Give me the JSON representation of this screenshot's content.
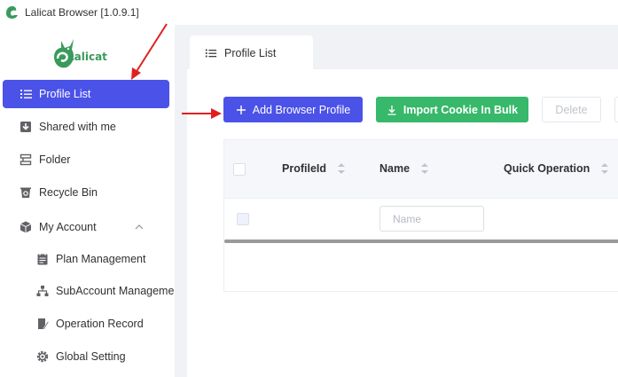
{
  "window": {
    "title": "Lalicat Browser  [1.0.9.1]"
  },
  "brand": {
    "name": "Lalicat"
  },
  "sidebar": {
    "items": [
      {
        "label": "Profile List",
        "icon": "list-icon",
        "active": true
      },
      {
        "label": "Shared with me",
        "icon": "download-icon"
      },
      {
        "label": "Folder",
        "icon": "folder-icon"
      },
      {
        "label": "Recycle Bin",
        "icon": "trash-icon"
      },
      {
        "label": "My Account",
        "icon": "box-icon",
        "expanded": true
      },
      {
        "label": "Plan Management",
        "icon": "calendar-icon",
        "sub": true
      },
      {
        "label": "SubAccount Managemen",
        "icon": "sitemap-icon",
        "sub": true
      },
      {
        "label": "Operation Record",
        "icon": "record-icon",
        "sub": true
      },
      {
        "label": "Global Setting",
        "icon": "gear-icon",
        "sub": true
      }
    ]
  },
  "tabs": [
    {
      "label": "Profile List",
      "icon": "list-icon"
    }
  ],
  "toolbar": {
    "add_label": "Add Browser Profile",
    "import_label": "Import Cookie In Bulk",
    "delete_label": "Delete"
  },
  "table": {
    "columns": [
      "ProfileId",
      "Name",
      "Quick Operation"
    ],
    "filters": {
      "name_placeholder": "Name"
    }
  },
  "colors": {
    "primary": "#4b52e8",
    "success": "#37b86a",
    "annotation": "#e02020",
    "brand": "#3a9a5c"
  }
}
